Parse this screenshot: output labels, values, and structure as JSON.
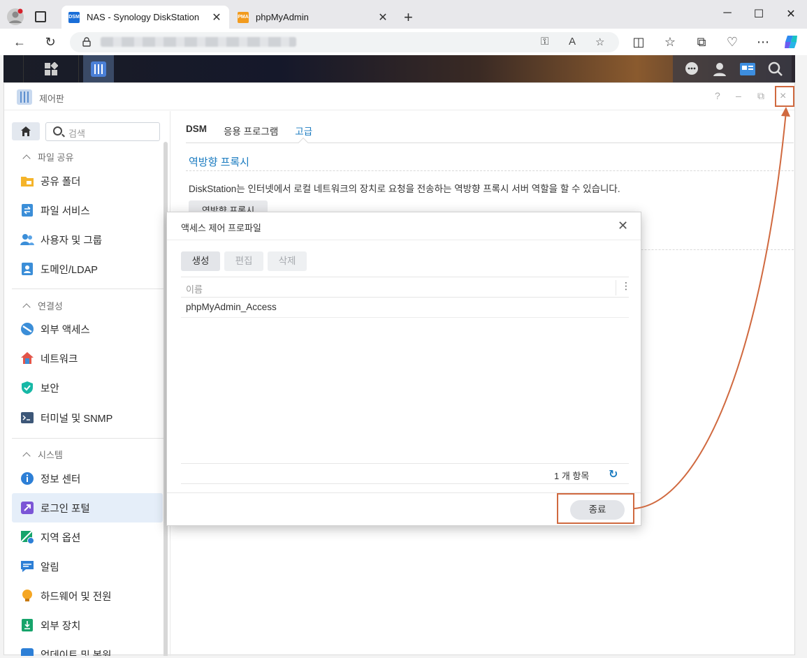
{
  "browser": {
    "tabs": [
      {
        "title": "NAS - Synology DiskStation",
        "favicon": "DSM",
        "active": true
      },
      {
        "title": "phpMyAdmin",
        "favicon": "PMA",
        "active": false
      }
    ],
    "new_tab": "+",
    "address_icons": [
      "key-icon",
      "read-aloud-icon",
      "favorite-star-icon"
    ],
    "toolbar_icons": [
      "split-screen-icon",
      "favorites-icon",
      "collections-icon",
      "browser-essentials-icon",
      "more-icon",
      "copilot-icon"
    ]
  },
  "control_panel": {
    "title": "제어판",
    "header_buttons": [
      "?",
      "–",
      "restore",
      "×"
    ],
    "search_placeholder": "검색",
    "sections": [
      {
        "label": "파일 공유",
        "items": [
          "공유 폴더",
          "파일 서비스",
          "사용자 및 그룹",
          "도메인/LDAP"
        ]
      },
      {
        "label": "연결성",
        "items": [
          "외부 액세스",
          "네트워크",
          "보안",
          "터미널 및 SNMP"
        ]
      },
      {
        "label": "시스템",
        "items": [
          "정보 센터",
          "로그인 포털",
          "지역 옵션",
          "알림",
          "하드웨어 및 전원",
          "외부 장치",
          "업데이트 및 복원"
        ]
      }
    ],
    "selected_item": "로그인 포털",
    "main": {
      "tabs": [
        "DSM",
        "응용 프로그램",
        "고급"
      ],
      "active_tab": "고급",
      "section_title": "역방향 프록시",
      "description": "DiskStation는 인터넷에서 로컬 네트워크의 장치로 요청을 전송하는 역방향 프록시 서버 역할을 할 수 있습니다.",
      "button_label": "역방향 프록시"
    }
  },
  "modal": {
    "title": "액세스 제어 프로파일",
    "buttons": {
      "create": "생성",
      "edit": "편집",
      "delete": "삭제"
    },
    "column_header": "이름",
    "rows": [
      "phpMyAdmin_Access"
    ],
    "count_text": "1 개 항목",
    "close_label": "종료"
  },
  "colors": {
    "accent": "#1a7bc0",
    "annotation": "#d0693f",
    "selected_bg": "#e5eef9"
  }
}
